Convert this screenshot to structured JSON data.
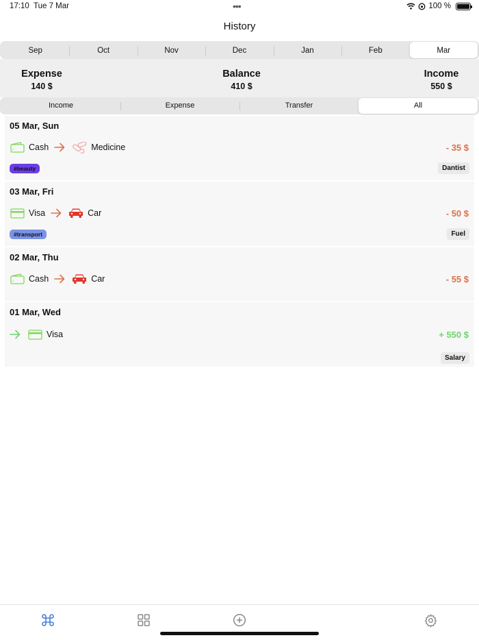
{
  "status": {
    "time": "17:10",
    "date": "Tue 7 Mar",
    "battery": "100 %"
  },
  "title": "History",
  "months": [
    {
      "label": "Sep",
      "active": false
    },
    {
      "label": "Oct",
      "active": false
    },
    {
      "label": "Nov",
      "active": false
    },
    {
      "label": "Dec",
      "active": false
    },
    {
      "label": "Jan",
      "active": false
    },
    {
      "label": "Feb",
      "active": false
    },
    {
      "label": "Mar",
      "active": true
    }
  ],
  "summary": {
    "expense_label": "Expense",
    "expense_value": "140 $",
    "balance_label": "Balance",
    "balance_value": "410 $",
    "income_label": "Income",
    "income_value": "550 $"
  },
  "types": [
    {
      "label": "Income",
      "active": false
    },
    {
      "label": "Expense",
      "active": false
    },
    {
      "label": "Transfer",
      "active": false
    },
    {
      "label": "All",
      "active": true
    }
  ],
  "transactions": [
    {
      "date": "05 Mar, Sun",
      "from": "Cash",
      "from_icon": "wallet-icon",
      "to": "Medicine",
      "to_icon": "pills-icon",
      "amount": "- 35 $",
      "tag": "#beauty",
      "note": "Dantist"
    },
    {
      "date": "03 Mar, Fri",
      "from": "Visa",
      "from_icon": "card-icon",
      "to": "Car",
      "to_icon": "car-icon",
      "amount": "- 50 $",
      "tag": "#transport",
      "note": "Fuel"
    },
    {
      "date": "02 Mar, Thu",
      "from": "Cash",
      "from_icon": "wallet-icon",
      "to": "Car",
      "to_icon": "car-icon",
      "amount": "- 55 $",
      "tag": "",
      "note": ""
    },
    {
      "date": "01 Mar, Wed",
      "from": "",
      "from_icon": "",
      "to": "Visa",
      "to_icon": "card-icon",
      "amount": "+ 550 $",
      "tag": "",
      "note": "Salary"
    }
  ],
  "colors": {
    "expense": "#d9734a",
    "income": "#6fd46f",
    "account_icon": "#7ed957",
    "category_icon": "#e3362b",
    "tag_beauty": "#6a3de8",
    "tag_transport": "#7a93e6",
    "tab_active": "#4a7bd6"
  },
  "tabs": [
    {
      "name": "history-tab",
      "icon": "command-icon",
      "active": true
    },
    {
      "name": "categories-tab",
      "icon": "grid-icon",
      "active": false
    },
    {
      "name": "add-tab",
      "icon": "plus-circle-icon",
      "active": false
    },
    {
      "name": "settings-tab",
      "icon": "gear-icon",
      "active": false
    }
  ]
}
